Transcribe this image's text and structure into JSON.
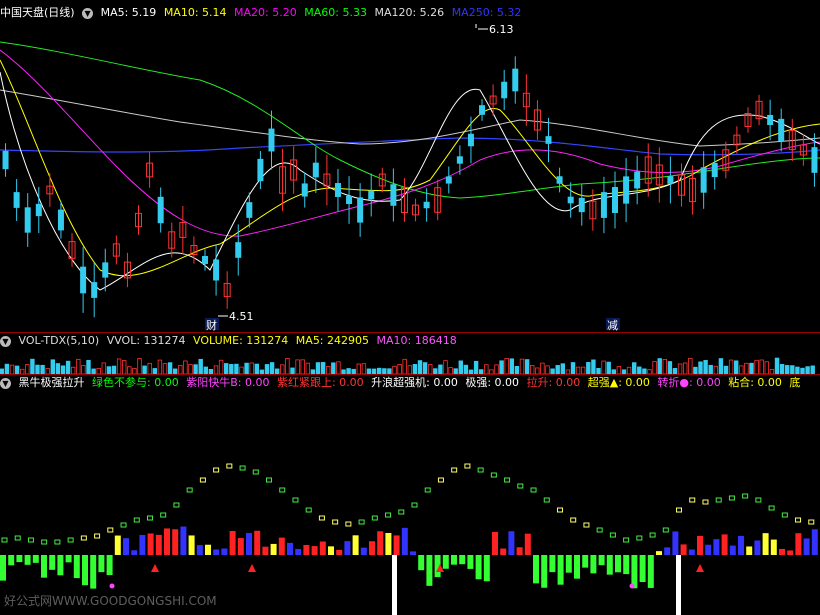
{
  "header": {
    "title": "中国天盘(日线)",
    "ma": [
      {
        "label": "MA5: 5.19",
        "color": "#ffffff"
      },
      {
        "label": "MA10: 5.14",
        "color": "#ffff00"
      },
      {
        "label": "MA20: 5.20",
        "color": "#ff00ff"
      },
      {
        "label": "MA60: 5.33",
        "color": "#00ff00"
      },
      {
        "label": "MA120: 5.26",
        "color": "#dddddd"
      },
      {
        "label": "MA250: 5.32",
        "color": "#3333ff"
      }
    ]
  },
  "price_chart": {
    "high_label": "6.13",
    "low_label": "4.51",
    "note_cai": "财",
    "note_jian": "减"
  },
  "volume": {
    "title": "VOL-TDX(5,10)",
    "items": [
      {
        "label": "VVOL: 131274",
        "color": "#dddddd"
      },
      {
        "label": "VOLUME: 131274",
        "color": "#ffff00"
      },
      {
        "label": "MA5: 242905",
        "color": "#ffff00"
      },
      {
        "label": "MA10: 186418",
        "color": "#ff55ff"
      }
    ]
  },
  "indicator": {
    "title": "黑牛极强拉升",
    "items": [
      {
        "label": "绿色不参与: 0.00",
        "color": "#00ff00"
      },
      {
        "label": "紫阳快牛B: 0.00",
        "color": "#ff44ff"
      },
      {
        "label": "紫红紧跟上: 0.00",
        "color": "#ff3333"
      },
      {
        "label": "升浪超强机: 0.00",
        "color": "#ffffff"
      },
      {
        "label": "极强: 0.00",
        "color": "#ffffff"
      },
      {
        "label": "拉升: 0.00",
        "color": "#ff3333"
      },
      {
        "label": "超强▲: 0.00",
        "color": "#ffff00"
      },
      {
        "label": "转折●: 0.00",
        "color": "#ff44ff"
      },
      {
        "label": "粘合: 0.00",
        "color": "#ffff00"
      },
      {
        "label": "底",
        "color": "#ffff00"
      }
    ]
  },
  "watermark": "好公式网WWW.GOODGONGSHI.COM"
}
